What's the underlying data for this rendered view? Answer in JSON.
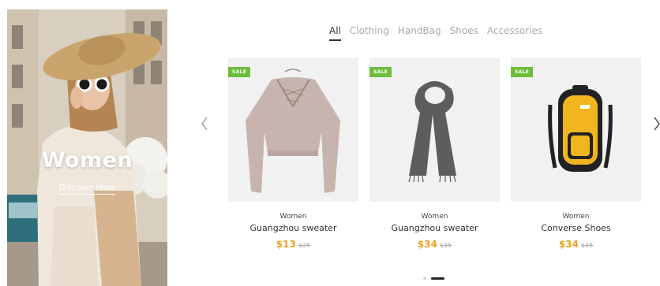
{
  "hero": {
    "title": "Women",
    "link_label": "Discover More"
  },
  "tabs": [
    {
      "label": "All",
      "active": true
    },
    {
      "label": "Clothing",
      "active": false
    },
    {
      "label": "HandBag",
      "active": false
    },
    {
      "label": "Shoes",
      "active": false
    },
    {
      "label": "Accessories",
      "active": false
    }
  ],
  "carousel": {
    "prev_icon": "chevron-left-icon",
    "next_icon": "chevron-right-icon",
    "active_slide": 2,
    "slide_count": 2
  },
  "products": [
    {
      "badge": "SALE",
      "category": "Women",
      "name": "Guangzhou sweater",
      "price": "$13",
      "old_price": "$35",
      "image_icon": "sweater-icon"
    },
    {
      "badge": "SALE",
      "category": "Women",
      "name": "Guangzhou sweater",
      "price": "$34",
      "old_price": "$35",
      "image_icon": "scarf-icon"
    },
    {
      "badge": "SALE",
      "category": "Women",
      "name": "Converse Shoes",
      "price": "$34",
      "old_price": "$35",
      "image_icon": "backpack-icon"
    }
  ],
  "colors": {
    "sale_badge": "#6cbd3a",
    "price": "#e8a323",
    "active_tab": "#333333",
    "inactive_tab": "#aaaaaa"
  }
}
